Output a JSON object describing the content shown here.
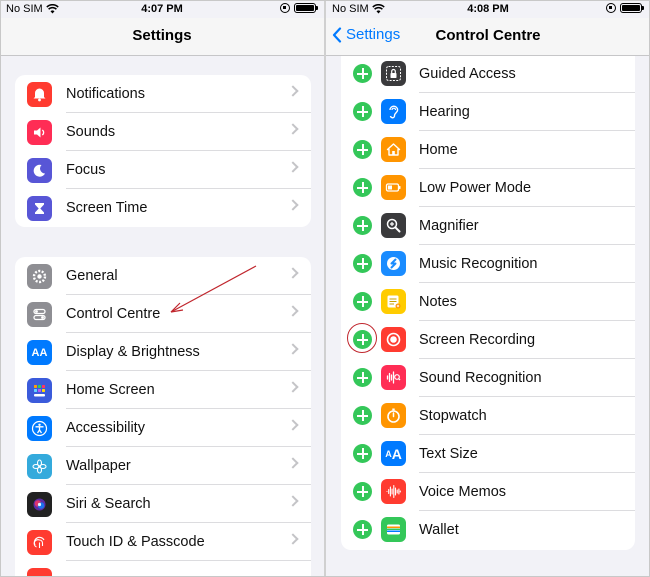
{
  "left": {
    "status": {
      "carrier": "No SIM",
      "time": "4:07 PM"
    },
    "nav_title": "Settings",
    "group1": [
      {
        "label": "Notifications",
        "icon": "notifications-icon",
        "color": "#ff3b30"
      },
      {
        "label": "Sounds",
        "icon": "sounds-icon",
        "color": "#ff2d55"
      },
      {
        "label": "Focus",
        "icon": "focus-icon",
        "color": "#5856d6"
      },
      {
        "label": "Screen Time",
        "icon": "screen-time-icon",
        "color": "#5856d6"
      }
    ],
    "group2": [
      {
        "label": "General",
        "icon": "general-icon",
        "color": "#8e8e93"
      },
      {
        "label": "Control Centre",
        "icon": "control-centre-icon",
        "color": "#8e8e93"
      },
      {
        "label": "Display & Brightness",
        "icon": "display-icon",
        "color": "#007aff"
      },
      {
        "label": "Home Screen",
        "icon": "home-screen-icon",
        "color": "#3b5bdb"
      },
      {
        "label": "Accessibility",
        "icon": "accessibility-icon",
        "color": "#007aff"
      },
      {
        "label": "Wallpaper",
        "icon": "wallpaper-icon",
        "color": "#34aadc"
      },
      {
        "label": "Siri & Search",
        "icon": "siri-icon",
        "color": "#222222"
      },
      {
        "label": "Touch ID & Passcode",
        "icon": "touch-id-icon",
        "color": "#ff3b30"
      }
    ]
  },
  "right": {
    "status": {
      "carrier": "No SIM",
      "time": "4:08 PM"
    },
    "nav_title": "Control Centre",
    "back_label": "Settings",
    "items": [
      {
        "label": "Guided Access",
        "icon": "guided-access-icon",
        "color": "#3a3a3c"
      },
      {
        "label": "Hearing",
        "icon": "hearing-icon",
        "color": "#007aff"
      },
      {
        "label": "Home",
        "icon": "home-icon",
        "color": "#ff9500"
      },
      {
        "label": "Low Power Mode",
        "icon": "low-power-icon",
        "color": "#ff9500"
      },
      {
        "label": "Magnifier",
        "icon": "magnifier-icon",
        "color": "#3a3a3c"
      },
      {
        "label": "Music Recognition",
        "icon": "music-recognition-icon",
        "color": "#1a8cff"
      },
      {
        "label": "Notes",
        "icon": "notes-icon",
        "color": "#ffcc00"
      },
      {
        "label": "Screen Recording",
        "icon": "screen-recording-icon",
        "color": "#ff3b30"
      },
      {
        "label": "Sound Recognition",
        "icon": "sound-recognition-icon",
        "color": "#ff2d55"
      },
      {
        "label": "Stopwatch",
        "icon": "stopwatch-icon",
        "color": "#ff9500"
      },
      {
        "label": "Text Size",
        "icon": "text-size-icon",
        "color": "#007aff"
      },
      {
        "label": "Voice Memos",
        "icon": "voice-memos-icon",
        "color": "#ff3b30"
      },
      {
        "label": "Wallet",
        "icon": "wallet-icon",
        "color": "#34c759"
      }
    ]
  }
}
